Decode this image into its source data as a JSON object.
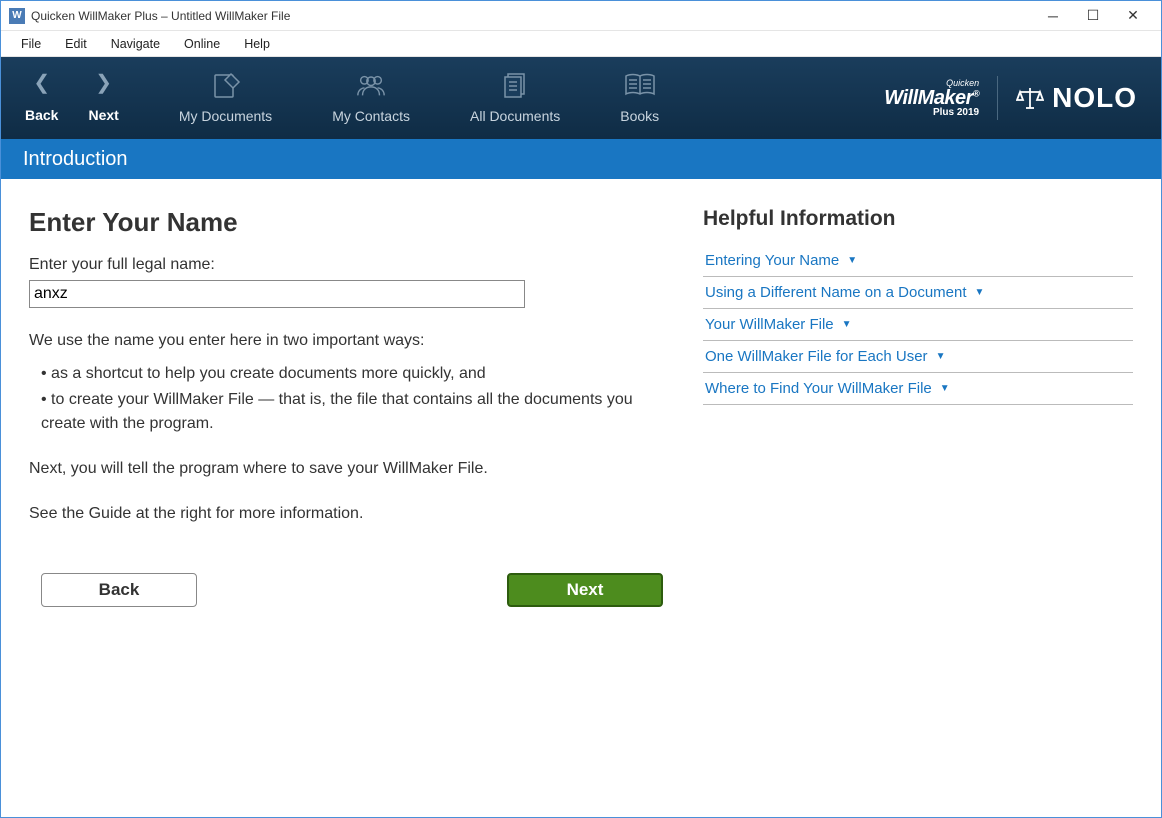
{
  "titlebar": {
    "icon_letter": "W",
    "title": "Quicken WillMaker Plus – Untitled WillMaker File"
  },
  "menu": [
    "File",
    "Edit",
    "Navigate",
    "Online",
    "Help"
  ],
  "toolbar": {
    "back": "Back",
    "next": "Next",
    "my_documents": "My Documents",
    "my_contacts": "My Contacts",
    "all_documents": "All Documents",
    "books": "Books"
  },
  "brand": {
    "quicken": "Quicken",
    "willmaker": "WillMaker",
    "plus": "Plus 2019",
    "nolo": "NOLO"
  },
  "section_header": "Introduction",
  "main": {
    "title": "Enter Your Name",
    "field_label": "Enter your full legal name:",
    "name_value": "anxz",
    "para_intro": "We use the name you enter here in two important ways:",
    "bullet1": "• as a shortcut to help you create documents more quickly, and",
    "bullet2": "• to create your WillMaker File — that is, the file that contains all the documents you create with the program.",
    "para_next": "Next, you will tell the program where to save your WillMaker File.",
    "para_guide": "See the Guide at the right for more information.",
    "back_btn": "Back",
    "next_btn": "Next"
  },
  "side": {
    "title": "Helpful Information",
    "links": [
      "Entering Your Name",
      "Using a Different Name on a Document",
      "Your WillMaker File",
      "One WillMaker File for Each User",
      "Where to Find Your WillMaker File"
    ]
  }
}
